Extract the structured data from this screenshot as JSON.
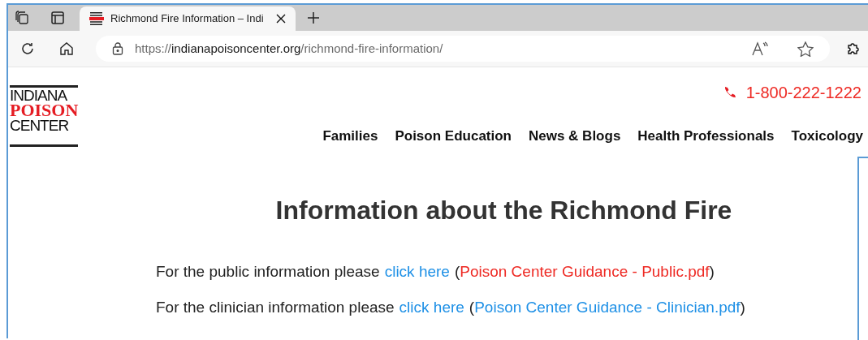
{
  "browser": {
    "tab": {
      "title": "Richmond Fire Information – Indi",
      "selected": true
    },
    "url": {
      "scheme": "https://",
      "host": "indianapoisoncenter.org",
      "path": "/richmond-fire-information/"
    }
  },
  "site": {
    "logo": {
      "line_1": "INDIANA",
      "line_2": "POISON",
      "line_3": "CENTER"
    },
    "phone": "1-800-222-1222",
    "nav": [
      "Families",
      "Poison Education",
      "News & Blogs",
      "Health Professionals",
      "Toxicology"
    ]
  },
  "content": {
    "heading": "Information about the Richmond Fire",
    "lines": [
      {
        "text": "For the public information please",
        "link": "click here",
        "open": "(",
        "file": "Poison Center Guidance - Public.pdf",
        "color": "#ee2a24",
        "close": ")"
      },
      {
        "text": "For the clinician information please",
        "link": "click here",
        "open": "(",
        "file": "Poison Center Guidance - Clinician.pdf",
        "color": "#1e90e6",
        "close": ")"
      }
    ]
  }
}
